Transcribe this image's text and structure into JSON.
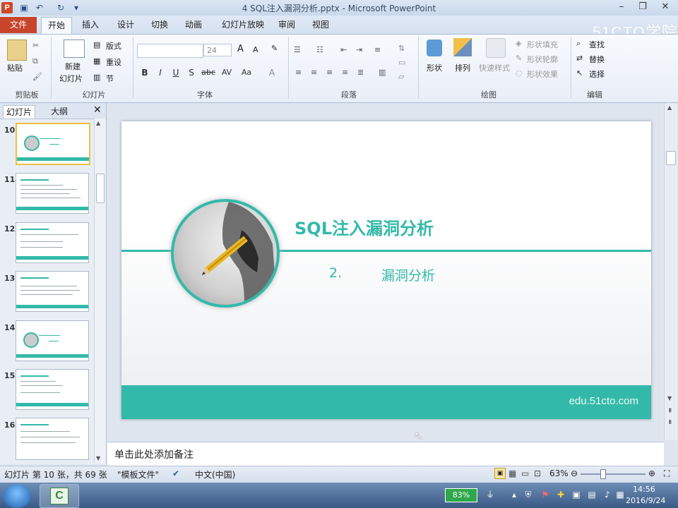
{
  "window": {
    "title": "4 SQL注入漏洞分析.pptx - Microsoft PowerPoint",
    "app_icon": "P",
    "quick_access": [
      "save-icon",
      "undo-icon",
      "redo-icon"
    ],
    "controls": [
      "minimize",
      "restore",
      "close"
    ]
  },
  "ribbon_tabs": {
    "file": "文件",
    "items": [
      "开始",
      "插入",
      "设计",
      "切换",
      "动画",
      "幻灯片放映",
      "审阅",
      "视图"
    ],
    "active": "开始"
  },
  "watermark": "51CTO学院",
  "ribbon": {
    "clipboard": {
      "paste": "粘贴",
      "label": "剪贴板"
    },
    "slides": {
      "new_slide_line1": "新建",
      "new_slide_line2": "幻灯片",
      "layout": "版式",
      "reset": "重设",
      "section": "节",
      "label": "幻灯片"
    },
    "font": {
      "size": "24",
      "grow": "A",
      "shrink": "A",
      "label": "字体",
      "format_buttons": [
        "B",
        "I",
        "U",
        "S",
        "abc",
        "AV",
        "Aa",
        "A"
      ]
    },
    "paragraph": {
      "label": "段落"
    },
    "drawing": {
      "shapes": "形状",
      "arrange": "排列",
      "quick_styles": "快速样式",
      "fill": "形状填充",
      "outline": "形状轮廓",
      "effects": "形状效果",
      "label": "绘图"
    },
    "editing": {
      "find": "查找",
      "replace": "替换",
      "select": "选择",
      "label": "编辑"
    }
  },
  "panel": {
    "tab_slides": "幻灯片",
    "tab_outline": "大纲",
    "thumbnails": [
      "10",
      "11",
      "12",
      "13",
      "14",
      "15",
      "16"
    ],
    "selected": "10"
  },
  "slide": {
    "title": "SQL注入漏洞分析",
    "number": "2.",
    "subtitle": "漏洞分析",
    "footer": "edu.51cto.com"
  },
  "notes": {
    "placeholder": "单击此处添加备注"
  },
  "status": {
    "slide_info": "幻灯片 第 10 张，共 69 张",
    "theme": "\"模板文件\"",
    "language": "中文(中国)",
    "zoom": "63%"
  },
  "taskbar": {
    "battery": "83%",
    "time": "14:56",
    "date": "2016/9/24"
  },
  "colors": {
    "accent": "#33b9a9",
    "file_tab": "#c8442a"
  }
}
